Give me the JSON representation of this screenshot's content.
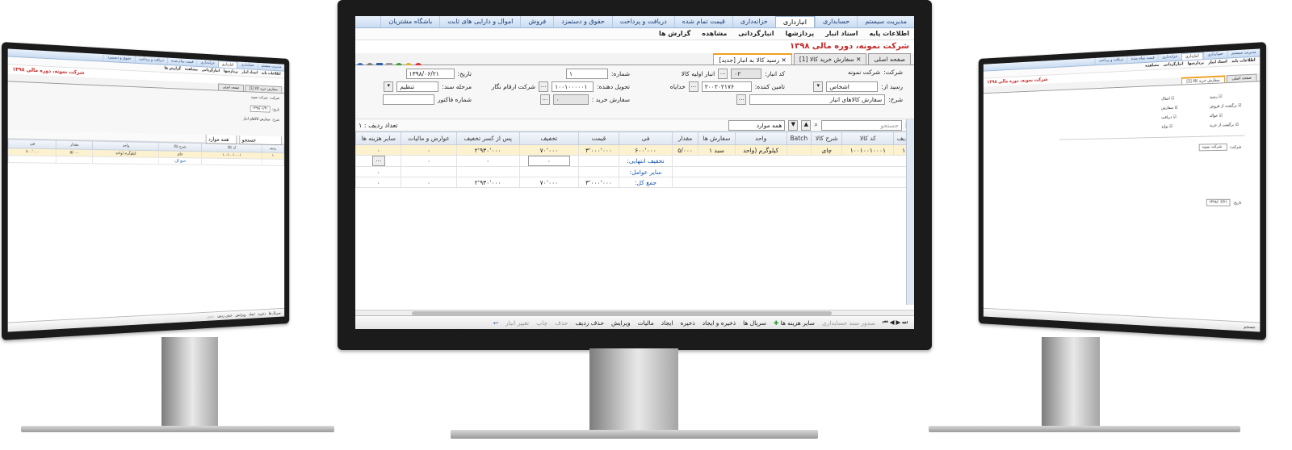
{
  "app": {
    "company_title": "شرکت نمونه، دوره مالی ۱۳۹۸",
    "top_tabs": [
      "مدیریت سیستم",
      "حسابداری",
      "انبارداری",
      "خزانه‌داری",
      "قیمت تمام شده",
      "دریافت و پرداخت",
      "حقوق و دستمزد",
      "فروش",
      "اموال و دارایی های ثابت",
      "باشگاه مشتریان"
    ],
    "active_top_tab": "انبارداری",
    "menu": [
      "اطلاعات پایه",
      "اسناد انبار",
      "پردازشها",
      "انبارگردانی",
      "مشاهده",
      "گزارش ها"
    ],
    "doc_tabs": [
      "صفحه اصلی",
      "سفارش خرید کالا [1]",
      "رسید کالا به انبار [جدید]"
    ],
    "active_doc_tab": "رسید کالا به انبار [جدید]"
  },
  "form": {
    "company_label": "شرکت:",
    "company_value": "شرکت نمونه",
    "warehouse_code_label": "کد انبار:",
    "warehouse_code_value": "۰۲",
    "warehouse_name_value": "انبار اولیه کالا",
    "number_label": "شماره:",
    "number_value": "۱",
    "date_label": "تاریخ:",
    "date_value": "۱۳۹۸/۰۶/۲۱",
    "receipt_from_label": "رسید از:",
    "receipt_from_value": "اشخاص",
    "supplier_label": "تامین کننده:",
    "supplier_code": "۲۰۰۲۰۲۱۷۶",
    "supplier_name": "خدایاه",
    "delivery_label": "تحویل دهنده:",
    "delivery_code": "۱۰۰۱۰۰۰۰۰۱",
    "delivery_name": "شرکت ارقام نگار",
    "stage_label": "مرحله سند:",
    "stage_value": "تنظیم",
    "description_label": "شرح:",
    "description_value": "سفارش کالاهای انبار",
    "purchase_order_label": "سفارش خرید :",
    "purchase_order_value": "۰",
    "invoice_number_label": "شماره فاکتور"
  },
  "toolbar": {
    "search_placeholder": "جستجو",
    "filter_value": "همه موارد",
    "row_count": "تعداد ردیف : ۱"
  },
  "grid": {
    "columns": [
      "ردیف",
      "کد کالا",
      "شرح کالا",
      "Batch",
      "واحد",
      "سفارش ها",
      "مقدار",
      "فی",
      "قیمت",
      "تخفیف",
      "پس از کسر تخفیف",
      "عوارض و مالیات",
      "سایر هزینه ها"
    ],
    "row": [
      "۱",
      "۱۰۰۱۰۰۱۰۰۰۱",
      "چای",
      "",
      "کیلوگرم (واحد",
      "سبد ۱",
      "۵/۰۰۰",
      "۶۰۰٬۰۰۰",
      "۳٬۰۰۰٬۰۰۰",
      "۷۰٬۰۰۰",
      "۲٬۹۳۰٬۰۰۰",
      "",
      ""
    ],
    "final_discount_label": "تخفیف انتهایی:",
    "final_discount_value": "۰",
    "other_costs_label": "سایر عوامل:",
    "total_label": "جمع کل:",
    "total_price": "۳٬۰۰۰٬۰۰۰",
    "total_discount": "۷۰٬۰۰۰",
    "total_after": "۲٬۹۳۰٬۰۰۰",
    "zero": "۰"
  },
  "bottom_actions": [
    "صدور سند حسابداری",
    "سایر هزینه ها",
    "سریال ها",
    "ذخیره و ایجاد",
    "ذخیره",
    "ایجاد",
    "مالیات",
    "ویرایش",
    "حذف ردیف",
    "حذف",
    "چاپ",
    "تغییر انبار"
  ],
  "right_screen": {
    "company_title": "شرکت نمونه، دوره مالی ۱۳۹۸",
    "checks": [
      "رسید",
      "برگشت از فروش",
      "حواله",
      "برگشت از خرید",
      "انتقال",
      "سفارش",
      "دریافت",
      "تولید"
    ]
  },
  "left_screen": {
    "company_title": "شرکت نمونه، دوره مالی ۱۳۹۸",
    "description_value": "سفارش کالاهای انبار"
  },
  "colors": {
    "accent_tab": "#f0a020",
    "company": "#c62828",
    "selected_row": "#fdf2cf"
  }
}
